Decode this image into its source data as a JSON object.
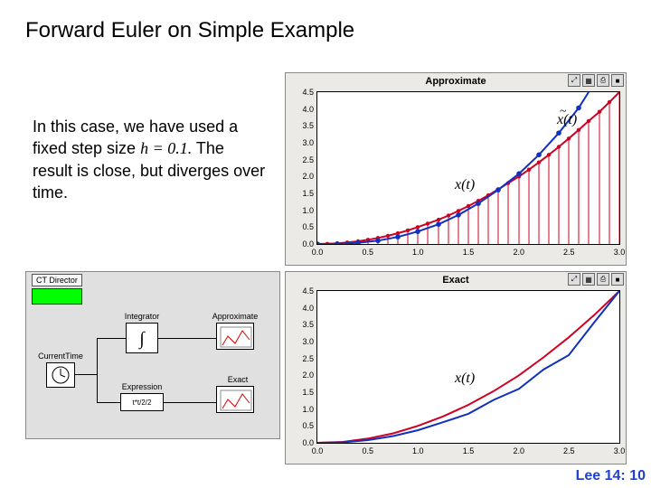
{
  "title": "Forward Euler on Simple Example",
  "description": {
    "line1": "In this case, we have used a fixed step size ",
    "h_eq": "h = 0.1.",
    "line2": " The result is close, but diverges over time."
  },
  "chart_data": [
    {
      "type": "line",
      "title": "Approximate",
      "xlabel": "",
      "ylabel": "",
      "xlim": [
        0,
        3
      ],
      "ylim": [
        0,
        4.5
      ],
      "yticks": [
        "0.0",
        "0.5",
        "1.0",
        "1.5",
        "2.0",
        "2.5",
        "3.0",
        "3.5",
        "4.0",
        "4.5"
      ],
      "xticks": [
        "0.0",
        "0.5",
        "1.0",
        "1.5",
        "2.0",
        "2.5",
        "3.0"
      ],
      "series": [
        {
          "name": "x_tilde(t)",
          "color": "#d00020",
          "x": [
            0,
            0.1,
            0.2,
            0.3,
            0.4,
            0.5,
            0.6,
            0.7,
            0.8,
            0.9,
            1.0,
            1.1,
            1.2,
            1.3,
            1.4,
            1.5,
            1.6,
            1.7,
            1.8,
            1.9,
            2.0,
            2.1,
            2.2,
            2.3,
            2.4,
            2.5,
            2.6,
            2.7,
            2.8,
            2.9,
            3.0
          ],
          "values": [
            0,
            0.005,
            0.02,
            0.045,
            0.08,
            0.125,
            0.18,
            0.245,
            0.32,
            0.405,
            0.5,
            0.605,
            0.72,
            0.845,
            0.98,
            1.125,
            1.28,
            1.445,
            1.62,
            1.805,
            2.0,
            2.205,
            2.42,
            2.645,
            2.88,
            3.125,
            3.38,
            3.645,
            3.92,
            4.205,
            4.5
          ]
        },
        {
          "name": "x(t)",
          "color": "#1030c0",
          "x": [
            0,
            0.1,
            0.2,
            0.3,
            0.4,
            0.5,
            0.6,
            0.7,
            0.8,
            0.9,
            1.0,
            1.1,
            1.2,
            1.3,
            1.4,
            1.5,
            1.6,
            1.7,
            1.8,
            1.9,
            2.0,
            2.1,
            2.2,
            2.3,
            2.4,
            2.5,
            2.6,
            2.7,
            2.8,
            2.9,
            3.0
          ],
          "values": [
            0,
            0,
            0.005,
            0.015,
            0.035,
            0.06,
            0.1,
            0.15,
            0.21,
            0.285,
            0.37,
            0.47,
            0.585,
            0.715,
            0.86,
            1.02,
            1.2,
            1.395,
            1.605,
            1.835,
            2.085,
            2.355,
            2.645,
            2.955,
            3.29,
            3.645,
            4.025,
            4.43,
            4.5,
            4.5,
            4.5
          ]
        }
      ],
      "annotations": [
        {
          "text": "x̃(t)",
          "pos": "upper-right"
        },
        {
          "text": "x(t)",
          "pos": "middle"
        }
      ]
    },
    {
      "type": "line",
      "title": "Exact",
      "xlabel": "",
      "ylabel": "",
      "xlim": [
        0,
        3
      ],
      "ylim": [
        0,
        4.5
      ],
      "yticks": [
        "0.0",
        "0.5",
        "1.0",
        "1.5",
        "2.0",
        "2.5",
        "3.0",
        "3.5",
        "4.0",
        "4.5"
      ],
      "xticks": [
        "0.0",
        "0.5",
        "1.0",
        "1.5",
        "2.0",
        "2.5",
        "3.0"
      ],
      "series": [
        {
          "name": "x(t)_red",
          "color": "#d00020",
          "x": [
            0,
            0.5,
            1.0,
            1.5,
            2.0,
            2.5,
            3.0
          ],
          "values": [
            0,
            0.125,
            0.5,
            1.125,
            2.0,
            3.125,
            4.5
          ]
        },
        {
          "name": "x(t)_blue",
          "color": "#1030c0",
          "x": [
            0,
            0.5,
            1.0,
            1.5,
            2.0,
            2.5,
            3.0
          ],
          "values": [
            0,
            0.08,
            0.37,
            0.86,
            1.6,
            2.6,
            4.5
          ]
        }
      ],
      "annotations": [
        {
          "text": "x(t)",
          "pos": "middle"
        }
      ]
    }
  ],
  "diagram": {
    "director": "CT Director",
    "blocks": {
      "currenttime": "CurrentTime",
      "integrator": "Integrator",
      "approximate": "Approximate",
      "expression": "Expression",
      "expr_value": "t*t/2/2",
      "exact": "Exact"
    }
  },
  "plot_icons": [
    "⤢",
    "▦",
    "⎙",
    "■"
  ],
  "footer": "Lee 14: 10"
}
